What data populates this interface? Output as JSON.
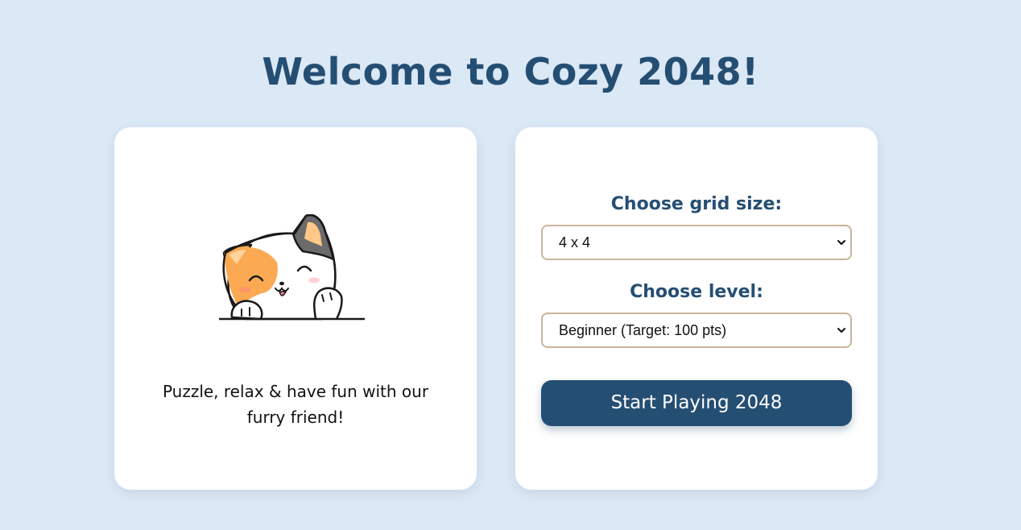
{
  "page": {
    "title": "Welcome to Cozy 2048!"
  },
  "intro_card": {
    "mascot_icon": "calico-cat-icon",
    "tagline": "Puzzle, relax & have fun with our furry friend!"
  },
  "settings_card": {
    "grid_label": "Choose grid size:",
    "grid_value": "4 x 4",
    "level_label": "Choose level:",
    "level_value": "Beginner (Target: 100 pts)",
    "start_label": "Start Playing 2048"
  },
  "colors": {
    "background": "#dbe8f5",
    "accent": "#254e73",
    "select_border": "#c7b699",
    "cat_orange": "#fba952",
    "cat_grey": "#6b6b6b"
  }
}
